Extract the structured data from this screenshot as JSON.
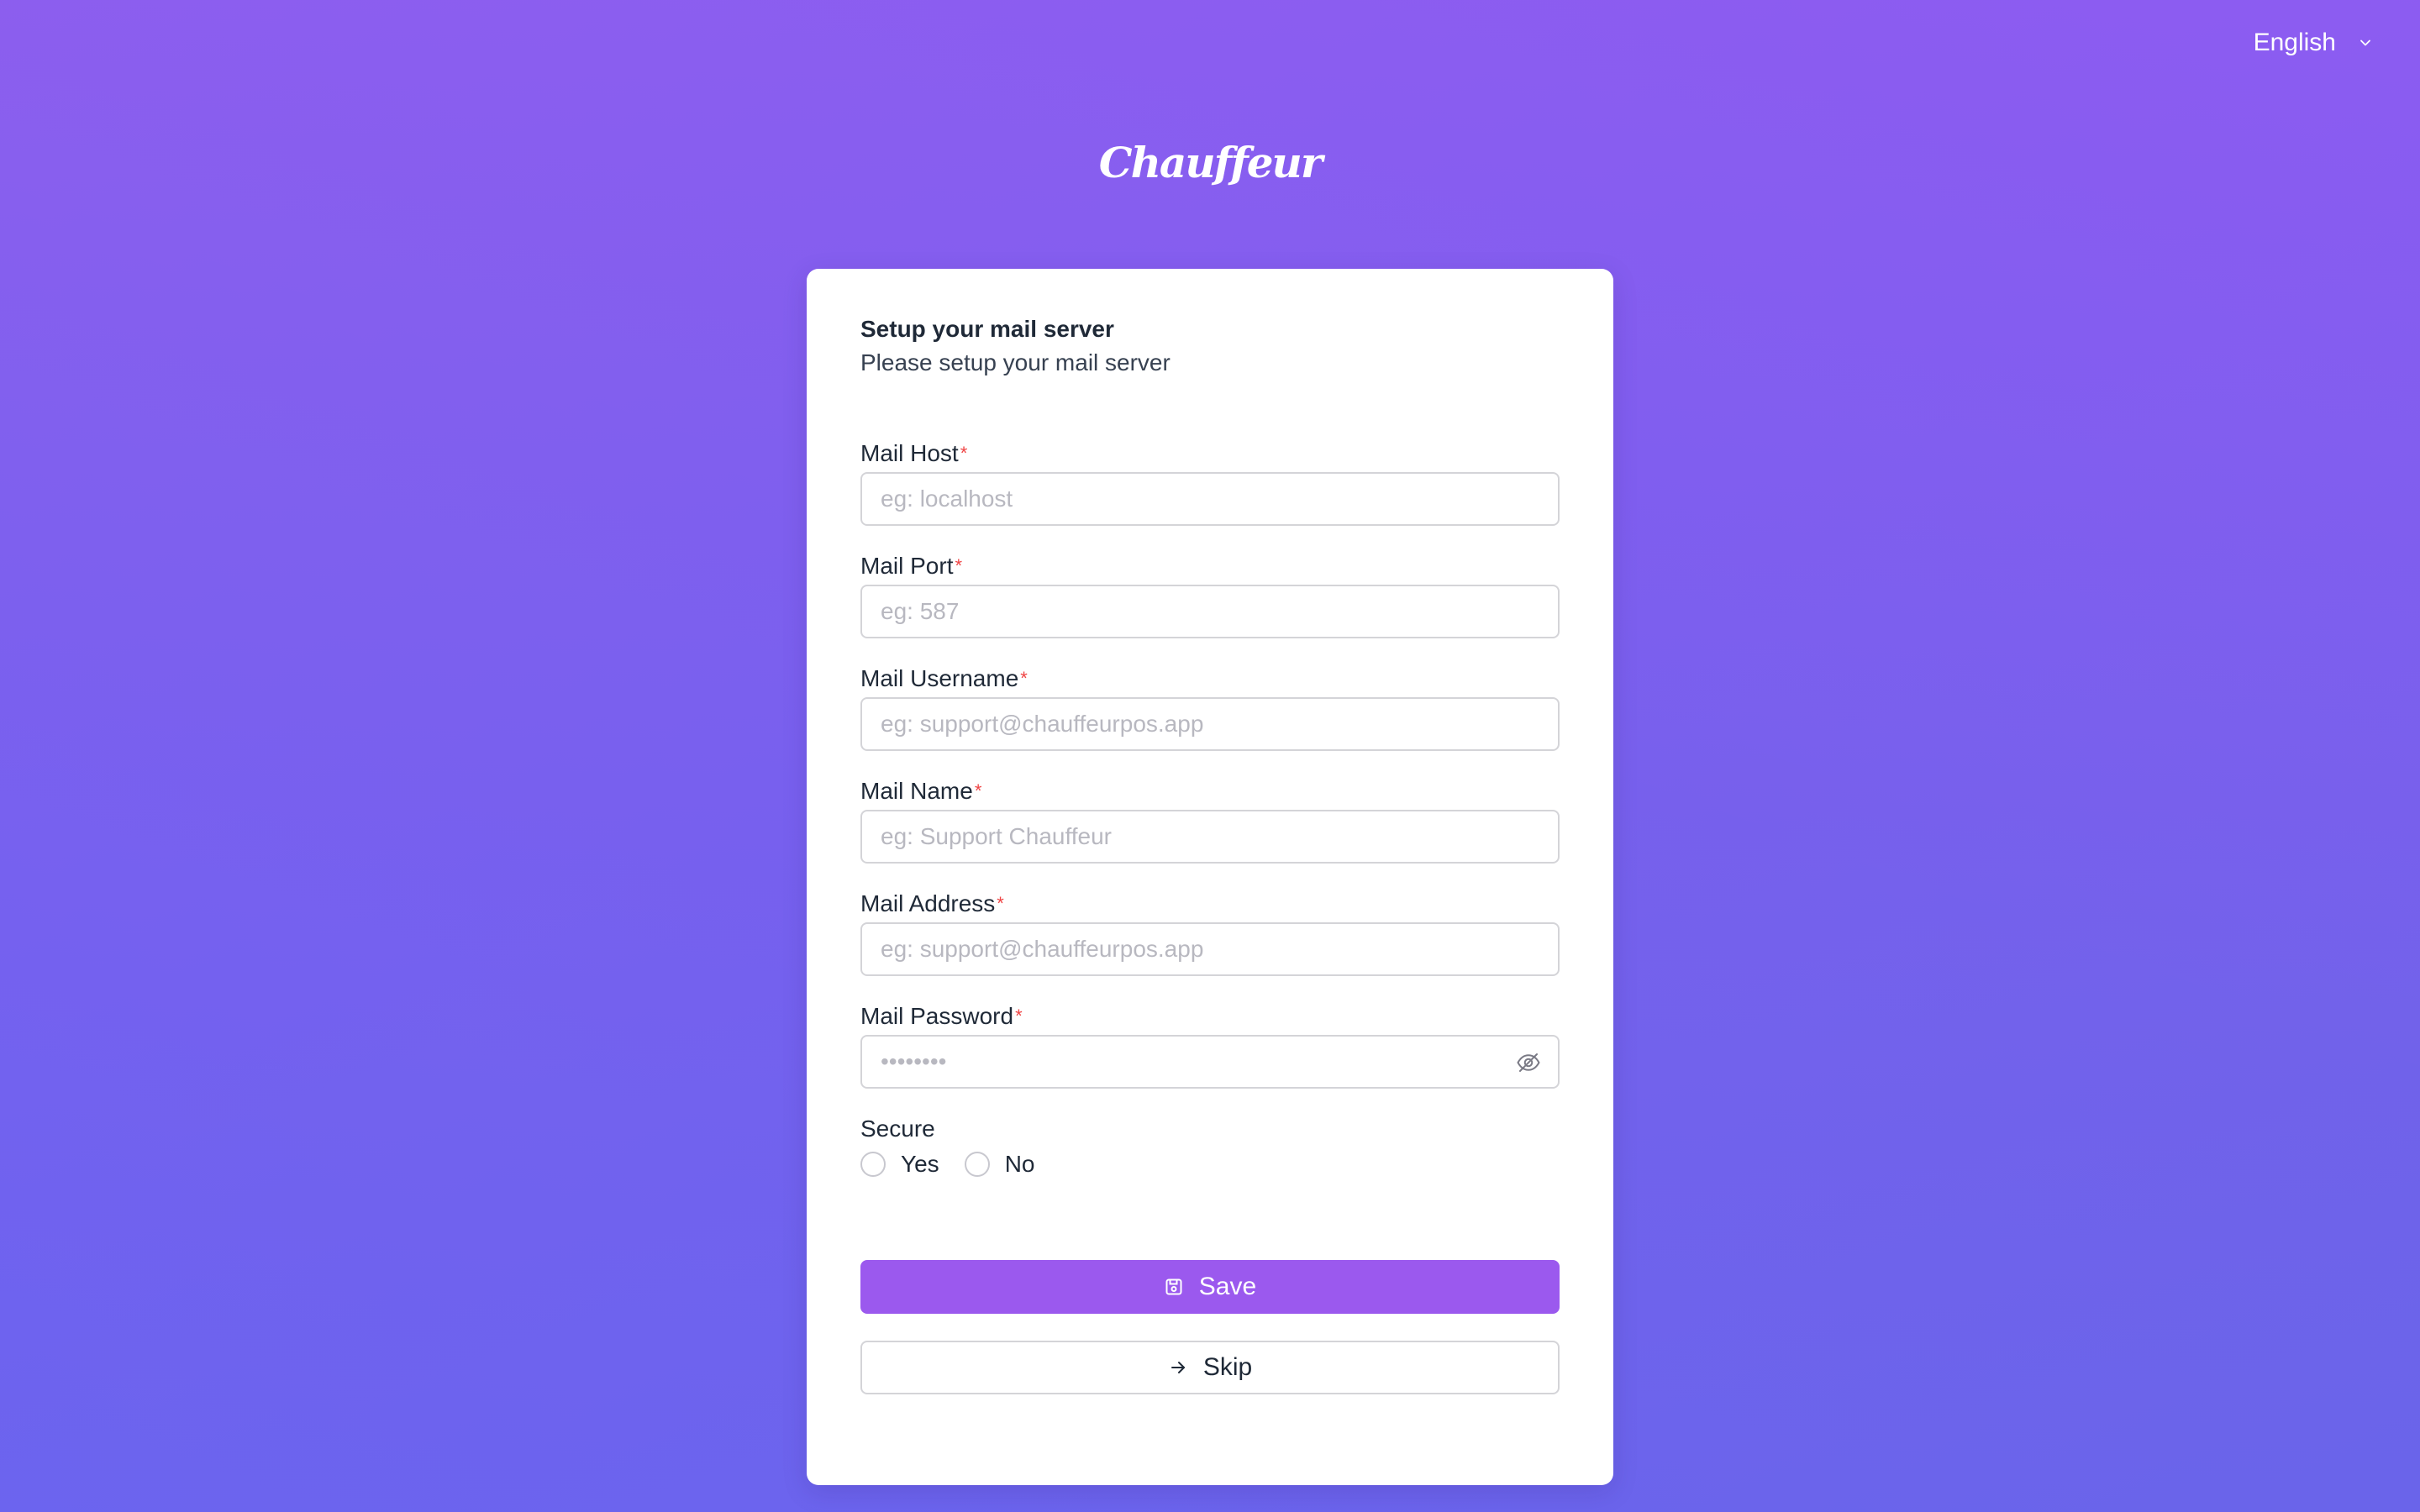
{
  "language": {
    "selected": "English"
  },
  "logo": {
    "text": "Chauffeur"
  },
  "card": {
    "title": "Setup your mail server",
    "subtitle": "Please setup your mail server"
  },
  "fields": {
    "mail_host": {
      "label": "Mail Host",
      "placeholder": "eg: localhost",
      "value": ""
    },
    "mail_port": {
      "label": "Mail Port",
      "placeholder": "eg: 587",
      "value": ""
    },
    "mail_username": {
      "label": "Mail Username",
      "placeholder": "eg: support@chauffeurpos.app",
      "value": ""
    },
    "mail_name": {
      "label": "Mail Name",
      "placeholder": "eg: Support Chauffeur",
      "value": ""
    },
    "mail_address": {
      "label": "Mail Address",
      "placeholder": "eg: support@chauffeurpos.app",
      "value": ""
    },
    "mail_password": {
      "label": "Mail Password",
      "placeholder": "••••••••",
      "value": ""
    }
  },
  "required_marker": "*",
  "secure": {
    "label": "Secure",
    "options": [
      "Yes",
      "No"
    ],
    "selected": null
  },
  "buttons": {
    "save": "Save",
    "skip": "Skip"
  },
  "icons": {
    "language_chevron": "chevron-down-icon",
    "password_toggle": "eye-off-icon",
    "save": "floppy-disk-icon",
    "skip": "arrow-right-icon"
  },
  "colors": {
    "background_start": "#8a5fee",
    "background_end": "#6b64e8",
    "primary_button": "#9b59ee",
    "required": "#ef4444",
    "card": "#ffffff"
  }
}
